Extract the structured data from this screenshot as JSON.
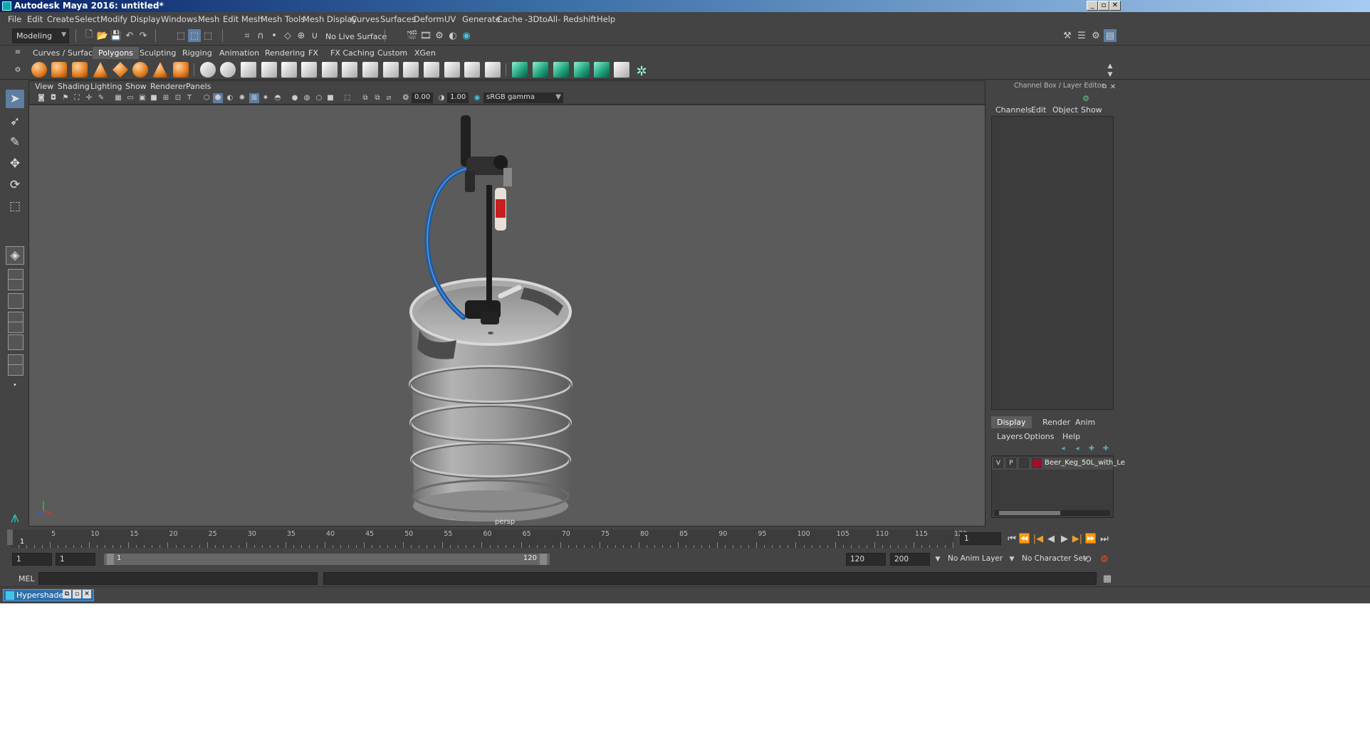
{
  "window": {
    "title": "Autodesk Maya 2016: untitled*"
  },
  "menubar": [
    "File",
    "Edit",
    "Create",
    "Select",
    "Modify",
    "Display",
    "Windows",
    "Mesh",
    "Edit Mesh",
    "Mesh Tools",
    "Mesh Display",
    "Curves",
    "Surfaces",
    "Deform",
    "UV",
    "Generate",
    "Cache",
    "-3DtoAll-",
    "Redshift",
    "Help"
  ],
  "statusline": {
    "mode": "Modeling",
    "live_surface": "No Live Surface"
  },
  "shelf_tabs": [
    "Curves / Surfaces",
    "Polygons",
    "Sculpting",
    "Rigging",
    "Animation",
    "Rendering",
    "FX",
    "FX Caching",
    "Custom",
    "XGen"
  ],
  "shelf_active": "Polygons",
  "viewport": {
    "menu": [
      "View",
      "Shading",
      "Lighting",
      "Show",
      "Renderer",
      "Panels"
    ],
    "exposure": "0.00",
    "gamma": "1.00",
    "color_space": "sRGB gamma",
    "camera": "persp"
  },
  "channel_box": {
    "title": "Channel Box / Layer Editor",
    "menu": [
      "Channels",
      "Edit",
      "Object",
      "Show"
    ],
    "tabs": [
      "Display",
      "Render",
      "Anim"
    ],
    "active_tab": "Display",
    "layer_menu": [
      "Layers",
      "Options",
      "Help"
    ],
    "layer": {
      "v": "V",
      "p": "P",
      "name": "Beer_Keg_50L_with_Le",
      "color": "#a0102a"
    }
  },
  "timeslider": {
    "ticks": [
      "1",
      "5",
      "10",
      "15",
      "20",
      "25",
      "30",
      "35",
      "40",
      "45",
      "50",
      "55",
      "60",
      "65",
      "70",
      "75",
      "80",
      "85",
      "90",
      "95",
      "100",
      "105",
      "110",
      "115",
      "120"
    ],
    "current_frame": "1"
  },
  "rangeslider": {
    "start": "1",
    "playback_start": "1",
    "range_start_label": "1",
    "range_end_label": "120",
    "playback_end": "120",
    "end": "200",
    "anim_layer": "No Anim Layer",
    "character_set": "No Character Set"
  },
  "cmdline": {
    "label": "MEL"
  },
  "taskbar": {
    "label": "Hypershade"
  }
}
